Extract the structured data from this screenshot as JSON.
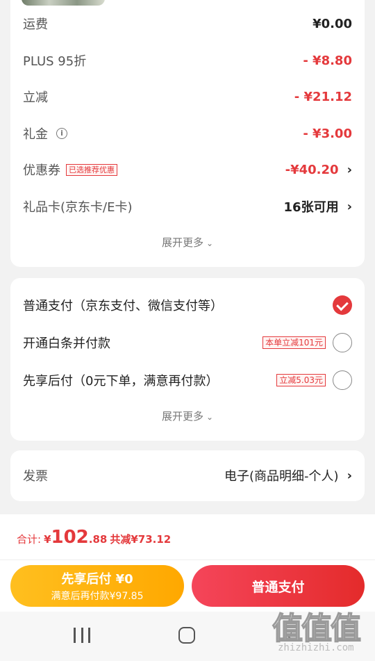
{
  "costs": {
    "rows": [
      {
        "label": "运费",
        "value": "¥0.00"
      },
      {
        "label": "PLUS 95折",
        "value": "- ¥8.80"
      },
      {
        "label": "立减",
        "value": "- ¥21.12"
      },
      {
        "label": "礼金",
        "value": "- ¥3.00"
      },
      {
        "label": "优惠券",
        "tag": "已选推荐优惠",
        "value": "-¥40.20"
      },
      {
        "label": "礼品卡(京东卡/E卡)",
        "value": "16张可用"
      }
    ],
    "info_glyph": "i",
    "expand_label": "展开更多"
  },
  "payment": {
    "options": [
      {
        "label": "普通支付（京东支付、微信支付等）",
        "selected": true
      },
      {
        "label": "开通白条并付款",
        "tag": "本单立减101元",
        "selected": false
      },
      {
        "label": "先享后付（0元下单，满意再付款）",
        "tag": "立减5.03元",
        "selected": false
      }
    ],
    "expand_label": "展开更多"
  },
  "invoice": {
    "label": "发票",
    "value": "电子(商品明细-个人)"
  },
  "footer": {
    "total_label": "合计:",
    "currency": "¥",
    "total_integer": "102",
    "total_decimal": ".88",
    "saved_label": "共减¥73.12",
    "later_button_line1": "先享后付 ¥0",
    "later_button_line2": "满意后再付款¥97.85",
    "normal_button": "普通支付"
  },
  "watermark": {
    "logo": "值值值",
    "url": "zhizhizhi.com"
  },
  "colors": {
    "accent": "#e4393c",
    "later_button": "#ffb20f"
  },
  "icons": {
    "chevron": "chevron-right-icon",
    "expand": "chevron-down-icon",
    "info": "info-icon",
    "check": "check-circle-icon",
    "nav_menu": "recent-apps-icon",
    "nav_home": "home-icon",
    "nav_back": "back-icon"
  }
}
